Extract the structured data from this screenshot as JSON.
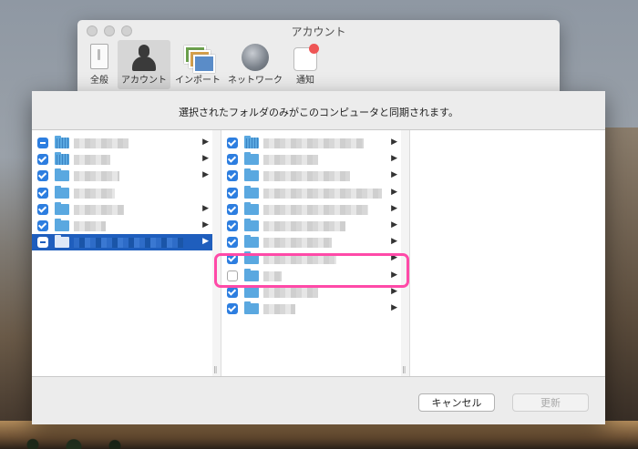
{
  "window": {
    "title": "アカウント"
  },
  "toolbar": {
    "items": [
      {
        "label": "全般",
        "icon": "general-icon",
        "selected": false
      },
      {
        "label": "アカウント",
        "icon": "account-icon",
        "selected": true
      },
      {
        "label": "インポート",
        "icon": "import-icon",
        "selected": false
      },
      {
        "label": "ネットワーク",
        "icon": "network-icon",
        "selected": false
      },
      {
        "label": "通知",
        "icon": "notification-icon",
        "selected": false
      }
    ]
  },
  "sheet": {
    "message": "選択されたフォルダのみがこのコンピュータと同期されます。",
    "cancel_label": "キャンセル",
    "update_label": "更新",
    "update_enabled": false
  },
  "column1": [
    {
      "check": "mixed",
      "folder": "grid",
      "has_children": true
    },
    {
      "check": "on",
      "folder": "grid",
      "has_children": true
    },
    {
      "check": "on",
      "folder": "plain",
      "has_children": true
    },
    {
      "check": "on",
      "folder": "plain",
      "has_children": false
    },
    {
      "check": "on",
      "folder": "plain",
      "has_children": true
    },
    {
      "check": "on",
      "folder": "plain",
      "has_children": true
    },
    {
      "check": "mixed",
      "folder": "plain",
      "has_children": true,
      "selected": true
    }
  ],
  "column2": [
    {
      "check": "on",
      "folder": "grid",
      "has_children": true
    },
    {
      "check": "on",
      "folder": "plain",
      "has_children": true
    },
    {
      "check": "on",
      "folder": "plain",
      "has_children": true
    },
    {
      "check": "on",
      "folder": "plain",
      "has_children": true
    },
    {
      "check": "on",
      "folder": "plain",
      "has_children": true
    },
    {
      "check": "on",
      "folder": "plain",
      "has_children": true
    },
    {
      "check": "on",
      "folder": "plain",
      "has_children": true
    },
    {
      "check": "on",
      "folder": "plain",
      "has_children": true
    },
    {
      "check": "off",
      "folder": "plain",
      "has_children": true,
      "highlighted": true
    },
    {
      "check": "on",
      "folder": "plain",
      "has_children": true
    },
    {
      "check": "on",
      "folder": "plain",
      "has_children": true
    }
  ],
  "colors": {
    "accent": "#2d7ee0",
    "selection": "#1f5ebd",
    "highlight": "#ff4aa8"
  }
}
